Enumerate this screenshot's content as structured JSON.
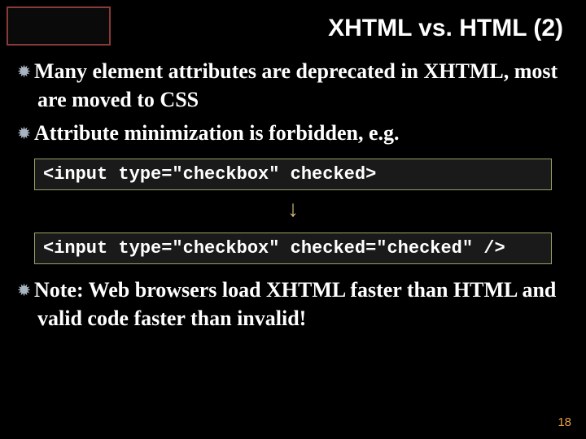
{
  "title": "XHTML vs. HTML (2)",
  "bullets": {
    "b1": "Many element attributes are deprecated in XHTML, most are moved to CSS",
    "b2": "Attribute minimization is forbidden, e.g.",
    "b3": "Note: Web browsers load XHTML faster than HTML and valid code faster than invalid!"
  },
  "code": {
    "before": "<input type=\"checkbox\" checked>",
    "after": "<input type=\"checkbox\" checked=\"checked\" />"
  },
  "arrow_glyph": "↓",
  "bullet_glyph": "✹",
  "page_number": "18"
}
